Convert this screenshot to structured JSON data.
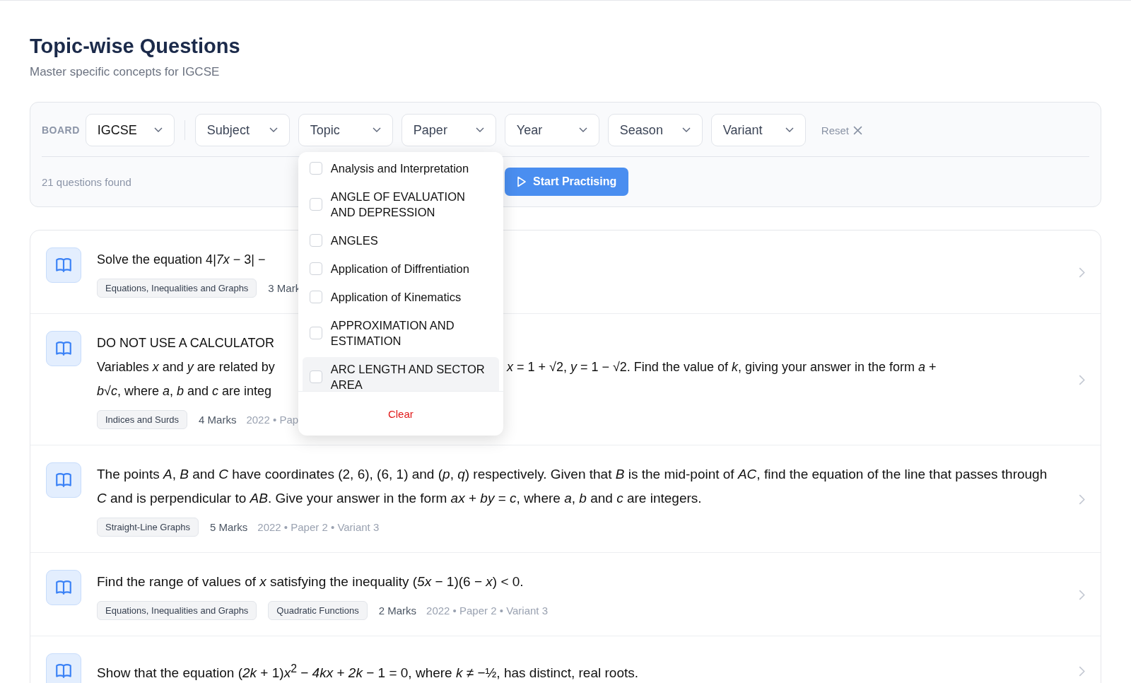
{
  "header": {
    "title": "Topic-wise Questions",
    "subtitle": "Master specific concepts for IGCSE"
  },
  "filters": {
    "board": {
      "label": "BOARD",
      "value": "IGCSE"
    },
    "selects": [
      {
        "label": "Subject"
      },
      {
        "label": "Topic",
        "menu": {
          "items": [
            {
              "label": "Analysis and Interpretation",
              "checked": false,
              "highlighted": false
            },
            {
              "label": "ANGLE OF EVALUATION AND DEPRESSION",
              "checked": false,
              "highlighted": false
            },
            {
              "label": "ANGLES",
              "checked": false,
              "highlighted": false
            },
            {
              "label": "Application of Diffrentiation",
              "checked": false,
              "highlighted": false
            },
            {
              "label": "Application of Kinematics",
              "checked": false,
              "highlighted": false
            },
            {
              "label": "APPROXIMATION AND ESTIMATION",
              "checked": false,
              "highlighted": false
            },
            {
              "label": "ARC LENGTH AND SECTOR AREA",
              "checked": false,
              "highlighted": true
            }
          ],
          "clear": "Clear"
        }
      },
      {
        "label": "Paper"
      },
      {
        "label": "Year"
      },
      {
        "label": "Season"
      },
      {
        "label": "Variant"
      }
    ],
    "reset": "Reset",
    "count": "21 questions found",
    "start_button": "Start Practising"
  },
  "questions": [
    {
      "lines": [
        {
          "left": "Solve the equation 4|*7x* − 3| −"
        }
      ],
      "tags": [
        "Equations, Inequalities and Graphs"
      ],
      "marks": "3 Mark"
    },
    {
      "lines": [
        {
          "left": "DO NOT USE A CALCULATOR"
        },
        {
          "left": "Variables *x* and *y* are related by",
          "right": "*x* = 1 + √2, *y* = 1 − √2. Find the value of *k*, giving your answer in the form *a* +"
        },
        {
          "left": "*b*√*c*, where *a*, *b* and *c* are integ"
        }
      ],
      "tags": [
        "Indices and Surds"
      ],
      "marks": "4 Marks",
      "source": "2022 • Pap"
    },
    {
      "text": "The points *A*, *B* and *C* have coordinates (2, 6), (6, 1) and (*p*, *q*) respectively. Given that *B* is the mid-point of *AC*, find the equation of the line that passes through *C* and is perpendicular to *AB*. Give your answer in the form *ax* + *by* = *c*, where *a*, *b* and *c* are integers.",
      "tags": [
        "Straight-Line Graphs"
      ],
      "marks": "5 Marks",
      "source": "2022 • Paper 2 • Variant 3"
    },
    {
      "text": "Find the range of values of *x* satisfying the inequality (*5x* − 1)(6 − *x*) < 0.",
      "tags": [
        "Equations, Inequalities and Graphs",
        "Quadratic Functions"
      ],
      "marks": "2 Marks",
      "source": "2022 • Paper 2 • Variant 3"
    },
    {
      "text": "Show that the equation (*2k* + 1)*x*$^{2}$ − *4kx* + *2k* − 1 = 0, where *k* ≠ −½, has distinct, real roots."
    }
  ]
}
